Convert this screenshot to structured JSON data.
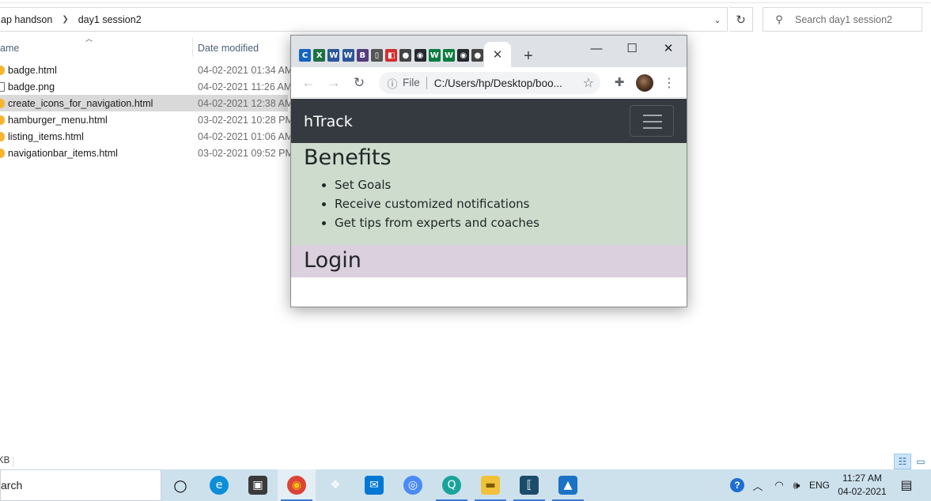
{
  "explorer": {
    "breadcrumbs": [
      "ap handson",
      "day1 session2"
    ],
    "search_placeholder": "Search day1 session2",
    "columns": {
      "name": "ame",
      "date": "Date modified"
    },
    "files": [
      {
        "name": "badge.html",
        "date": "04-02-2021 01:34 AM",
        "type": "html",
        "selected": false
      },
      {
        "name": "badge.png",
        "date": "04-02-2021 11:26 AM",
        "type": "png",
        "selected": false
      },
      {
        "name": "create_icons_for_navigation.html",
        "date": "04-02-2021 12:38 AM",
        "type": "html",
        "selected": true
      },
      {
        "name": "hamburger_menu.html",
        "date": "03-02-2021 10:28 PM",
        "type": "html",
        "selected": false
      },
      {
        "name": "listing_items.html",
        "date": "04-02-2021 01:06 AM",
        "type": "html",
        "selected": false
      },
      {
        "name": "navigationbar_items.html",
        "date": "03-02-2021 09:52 PM",
        "type": "html",
        "selected": false
      }
    ],
    "status_text": "KB"
  },
  "chrome": {
    "tab_favicons": [
      {
        "glyph": "C",
        "color": "#1565c0",
        "name": "c-favicon-icon"
      },
      {
        "glyph": "X",
        "color": "#1e7145",
        "name": "excel-favicon-icon"
      },
      {
        "glyph": "W",
        "color": "#2b579a",
        "name": "word-favicon-icon"
      },
      {
        "glyph": "W",
        "color": "#2b579a",
        "name": "word-favicon-icon"
      },
      {
        "glyph": "B",
        "color": "#563d7c",
        "name": "bootstrap-favicon-icon"
      },
      {
        "glyph": "▯",
        "color": "#555555",
        "name": "doc-favicon-icon"
      },
      {
        "glyph": "◧",
        "color": "#d32f2f",
        "name": "pdf-favicon-icon"
      },
      {
        "glyph": "●",
        "color": "#444444",
        "name": "globe-favicon-icon"
      },
      {
        "glyph": "◉",
        "color": "#24292e",
        "name": "github-favicon-icon"
      },
      {
        "glyph": "W",
        "color": "#0a7d3e",
        "name": "w-favicon-icon"
      },
      {
        "glyph": "W",
        "color": "#0a7d3e",
        "name": "w-favicon-icon"
      },
      {
        "glyph": "◉",
        "color": "#24292e",
        "name": "github-favicon-icon"
      },
      {
        "glyph": "●",
        "color": "#444444",
        "name": "globe-favicon-icon"
      }
    ],
    "address": {
      "scheme_label": "File",
      "url": "C:/Users/hp/Desktop/boo..."
    },
    "page": {
      "brand": "hTrack",
      "benefits_title": "Benefits",
      "benefits": [
        "Set Goals",
        "Receive customized notifications",
        "Get tips from experts and coaches"
      ],
      "login_title": "Login",
      "colors": {
        "navbar": "#343a40",
        "benefits_bg": "#cddccc",
        "login_bg": "#dbd0dd"
      }
    }
  },
  "taskbar": {
    "search_text": "arch",
    "apps": [
      {
        "name": "cortana-icon",
        "glyph": "○",
        "color": "transparent",
        "fg": "#111111",
        "open": false,
        "active": false
      },
      {
        "name": "edge-icon",
        "glyph": "e",
        "color": "#0c8ed9",
        "fg": "#ffffff",
        "open": false,
        "active": false
      },
      {
        "name": "store-icon",
        "glyph": "▣",
        "color": "#3a3a3a",
        "fg": "#ffffff",
        "open": false,
        "active": false
      },
      {
        "name": "chrome-icon",
        "glyph": "◉",
        "color": "#db4437",
        "fg": "#f4c20d",
        "open": true,
        "active": true
      },
      {
        "name": "dropbox-icon",
        "glyph": "❖",
        "color": "transparent",
        "fg": "#ffffff",
        "open": false,
        "active": false
      },
      {
        "name": "mail-icon",
        "glyph": "✉",
        "color": "#0078d4",
        "fg": "#ffffff",
        "open": false,
        "active": false
      },
      {
        "name": "chromium-icon",
        "glyph": "◎",
        "color": "#4a8af4",
        "fg": "#ffffff",
        "open": false,
        "active": false
      },
      {
        "name": "app-q-icon",
        "glyph": "Q",
        "color": "#1aa39a",
        "fg": "#ffffff",
        "open": true,
        "active": false
      },
      {
        "name": "file-explorer-icon",
        "glyph": "▬",
        "color": "#f2c13a",
        "fg": "#7a5b00",
        "open": true,
        "active": false
      },
      {
        "name": "app-bracket-icon",
        "glyph": "⟦",
        "color": "#1b4d6b",
        "fg": "#ffffff",
        "open": true,
        "active": false
      },
      {
        "name": "photos-icon",
        "glyph": "▲",
        "color": "#1b73c6",
        "fg": "#ffffff",
        "open": true,
        "active": false
      }
    ],
    "lang": "ENG",
    "time": "11:27 AM",
    "date": "04-02-2021"
  }
}
